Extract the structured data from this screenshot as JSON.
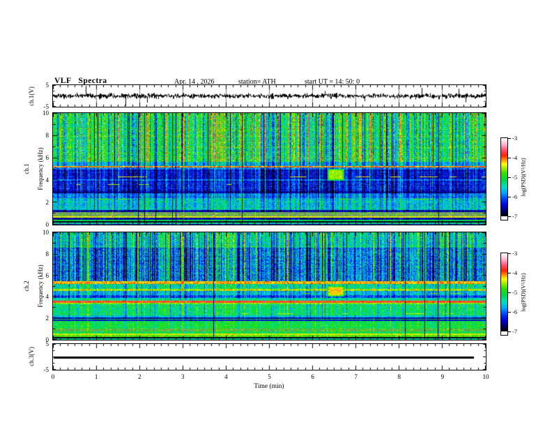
{
  "header": {
    "title": "VLF  Spectra",
    "date": "Apr. 14 , 2026",
    "station": "station= ATH",
    "start_ut": "start  UT  =   14: 50: 0"
  },
  "axes": {
    "x": {
      "label": "Time  (min)",
      "min": 0,
      "max": 10,
      "tick_labels": [
        "0",
        "1",
        "2",
        "3",
        "4",
        "5",
        "6",
        "7",
        "8",
        "9",
        "10"
      ],
      "minor_divisions": 6
    },
    "spec_y": {
      "min": 0,
      "max": 10,
      "tick_labels": [
        "10",
        "8",
        "6",
        "4",
        "2",
        "0"
      ]
    },
    "volt_y": {
      "min": -5,
      "max": 5,
      "tick_labels": [
        "5",
        "-5"
      ]
    }
  },
  "panels": {
    "ch1_wave": {
      "ylabel": "ch.1(V)"
    },
    "ch1_spec": {
      "label_line1": "ch.1",
      "label_line2": "Frequency  (kHz)"
    },
    "ch2_spec": {
      "label_line1": "ch.2",
      "label_line2": "Frequency  (kHz)"
    },
    "ch3_wave": {
      "ylabel": "ch.3(V)"
    }
  },
  "colorbar": {
    "label": "log(PSD)(V²/Hz)",
    "min": -7,
    "max": -3,
    "tick_labels": [
      "-3",
      "-4",
      "-5",
      "-6",
      "-7"
    ],
    "stops": [
      [
        0.0,
        "#000000"
      ],
      [
        0.06,
        "#000060"
      ],
      [
        0.14,
        "#0000e0"
      ],
      [
        0.22,
        "#0040ff"
      ],
      [
        0.3,
        "#00a8ff"
      ],
      [
        0.38,
        "#00e0c0"
      ],
      [
        0.47,
        "#00d840"
      ],
      [
        0.55,
        "#30e000"
      ],
      [
        0.62,
        "#a8f000"
      ],
      [
        0.67,
        "#ffff00"
      ],
      [
        0.72,
        "#ff9800"
      ],
      [
        0.78,
        "#ff2000"
      ],
      [
        0.85,
        "#ff5070"
      ],
      [
        0.92,
        "#ffb0d0"
      ],
      [
        1.0,
        "#ffffff"
      ]
    ]
  },
  "chart_data": [
    {
      "type": "line",
      "name": "ch1_voltage",
      "ylabel": "ch.1(V)",
      "xlim": [
        0,
        10
      ],
      "ylim": [
        -5,
        5
      ],
      "signal": {
        "kind": "broadband-noise",
        "mean": 0,
        "std": 0.55,
        "spike_rate": 0.015,
        "spike_amp_min": 2.0,
        "spike_amp_max": 4.8
      },
      "gridlines_every_min": 1
    },
    {
      "type": "heatmap",
      "name": "ch1_spectrogram",
      "xlim": [
        0,
        10
      ],
      "ylim": [
        0,
        10
      ],
      "zlim": [
        -7,
        -3
      ],
      "zlabel": "log(PSD)(V²/Hz)",
      "bands": [
        {
          "f": [
            5.6,
            10.0
          ],
          "level": -5.05,
          "noise": 0.5,
          "streak": 1.0
        },
        {
          "f": [
            5.28,
            5.6
          ],
          "level": -5.7,
          "noise": 0.3,
          "streak": 0.7
        },
        {
          "f": [
            5.1,
            5.28
          ],
          "level": -4.05,
          "noise": 0.3,
          "streak": 0.15
        },
        {
          "f": [
            4.92,
            5.1
          ],
          "level": -5.9,
          "noise": 0.3,
          "streak": 0.5
        },
        {
          "f": [
            4.08,
            4.92
          ],
          "level": -6.35,
          "noise": 0.35,
          "streak": 0.55
        },
        {
          "f": [
            3.94,
            4.08
          ],
          "level": -5.85,
          "noise": 0.3,
          "streak": 0.5
        },
        {
          "f": [
            3.0,
            3.94
          ],
          "level": -6.3,
          "noise": 0.4,
          "streak": 0.55
        },
        {
          "f": [
            2.84,
            3.0
          ],
          "level": -6.6,
          "noise": 0.25,
          "streak": 0.4
        },
        {
          "f": [
            2.4,
            2.84
          ],
          "level": -5.9,
          "noise": 0.35,
          "streak": 0.5
        },
        {
          "f": [
            1.32,
            2.4
          ],
          "level": -5.55,
          "noise": 0.4,
          "streak": 0.45
        },
        {
          "f": [
            1.15,
            1.32
          ],
          "level": -6.5,
          "noise": 0.3,
          "streak": 0.3
        },
        {
          "f": [
            0.72,
            1.15
          ],
          "level": -4.8,
          "noise": 0.35,
          "streak": 0.1,
          "gray": true,
          "grayMix": 0.65
        },
        {
          "f": [
            0.6,
            0.72
          ],
          "level": -4.3,
          "noise": 0.2,
          "streak": 0.1
        },
        {
          "f": [
            0.44,
            0.6
          ],
          "level": -6.5,
          "noise": 0.3,
          "streak": 0.3
        },
        {
          "f": [
            0.3,
            0.44
          ],
          "level": -5.1,
          "noise": 0.35,
          "streak": 0.2
        },
        {
          "f": [
            0.16,
            0.3
          ],
          "level": -6.9,
          "noise": 0.15,
          "streak": 0.08
        },
        {
          "f": [
            0.06,
            0.16
          ],
          "level": -5.3,
          "noise": 0.45,
          "streak": 0.15
        },
        {
          "f": [
            0.0,
            0.06
          ],
          "level": -6.4,
          "noise": 0.5,
          "streak": 0.1
        }
      ],
      "dashes": [
        {
          "f": 4.32,
          "level": -4.3,
          "p": 0.1
        },
        {
          "f": 3.64,
          "level": -4.5,
          "p": 0.07
        },
        {
          "f": 2.3,
          "level": -4.7,
          "p": 0.08
        }
      ],
      "blob": {
        "x": [
          6.33,
          6.72
        ],
        "f": [
          3.95,
          5.05
        ],
        "level": -4.55
      }
    },
    {
      "type": "heatmap",
      "name": "ch2_spectrogram",
      "xlim": [
        0,
        10
      ],
      "ylim": [
        0,
        10
      ],
      "zlim": [
        -7,
        -3
      ],
      "zlabel": "log(PSD)(V²/Hz)",
      "bands": [
        {
          "f": [
            8.6,
            10.0
          ],
          "level": -5.35,
          "noise": 0.45,
          "streak": 0.9
        },
        {
          "f": [
            5.45,
            8.6
          ],
          "level": -5.8,
          "noise": 0.5,
          "streak": 1.0
        },
        {
          "f": [
            5.18,
            5.45
          ],
          "level": -4.15,
          "noise": 0.3,
          "streak": 0.2
        },
        {
          "f": [
            4.75,
            5.18
          ],
          "level": -5.25,
          "noise": 0.4,
          "streak": 0.5
        },
        {
          "f": [
            4.52,
            4.75
          ],
          "level": -4.5,
          "noise": 0.4,
          "streak": 0.25
        },
        {
          "f": [
            4.18,
            4.52
          ],
          "level": -5.6,
          "noise": 0.35,
          "streak": 0.45
        },
        {
          "f": [
            3.9,
            4.18
          ],
          "level": -6.05,
          "noise": 0.35,
          "streak": 0.45
        },
        {
          "f": [
            3.62,
            3.9
          ],
          "level": -5.35,
          "noise": 0.3,
          "streak": 0.35
        },
        {
          "f": [
            3.46,
            3.62
          ],
          "level": -3.9,
          "noise": 0.3,
          "streak": 0.1
        },
        {
          "f": [
            3.3,
            3.46
          ],
          "level": -4.6,
          "noise": 0.25,
          "streak": 0.15
        },
        {
          "f": [
            2.3,
            3.3
          ],
          "level": -5.2,
          "noise": 0.4,
          "streak": 0.4
        },
        {
          "f": [
            2.1,
            2.3
          ],
          "level": -5.6,
          "noise": 0.3,
          "streak": 0.3
        },
        {
          "f": [
            1.96,
            2.1
          ],
          "level": -6.55,
          "noise": 0.3,
          "streak": 0.2
        },
        {
          "f": [
            1.86,
            1.96
          ],
          "level": -5.1,
          "noise": 0.3,
          "streak": 0.2
        },
        {
          "f": [
            1.76,
            1.86
          ],
          "level": -6.4,
          "noise": 0.25,
          "streak": 0.2
        },
        {
          "f": [
            1.05,
            1.76
          ],
          "level": -5.05,
          "noise": 0.35,
          "streak": 0.25
        },
        {
          "f": [
            0.8,
            1.05
          ],
          "level": -4.85,
          "noise": 0.3,
          "streak": 0.15,
          "gray": true,
          "grayMix": 0.4
        },
        {
          "f": [
            0.6,
            0.8
          ],
          "level": -5.15,
          "noise": 0.3,
          "streak": 0.2
        },
        {
          "f": [
            0.48,
            0.6
          ],
          "level": -4.35,
          "noise": 0.25,
          "streak": 0.1
        },
        {
          "f": [
            0.26,
            0.48
          ],
          "level": -4.7,
          "noise": 0.3,
          "streak": 0.12
        },
        {
          "f": [
            0.14,
            0.26
          ],
          "level": -6.9,
          "noise": 0.15,
          "streak": 0.05
        },
        {
          "f": [
            0.0,
            0.14
          ],
          "level": -5.4,
          "noise": 0.4,
          "streak": 0.1
        }
      ],
      "dashes": [
        {
          "f": 2.48,
          "level": -4.5,
          "p": 0.1
        },
        {
          "f": 4.35,
          "level": -4.6,
          "p": 0.06
        }
      ],
      "blob": {
        "x": [
          6.33,
          6.72
        ],
        "f": [
          4.05,
          5.05
        ],
        "level": -4.25
      }
    },
    {
      "type": "line",
      "name": "ch3_voltage",
      "ylabel": "ch.3(V)",
      "xlim": [
        0,
        10
      ],
      "ylim": [
        -5,
        5
      ],
      "signal": {
        "kind": "flat",
        "value": 0,
        "x_end": 9.73,
        "thickness": 3
      }
    }
  ]
}
